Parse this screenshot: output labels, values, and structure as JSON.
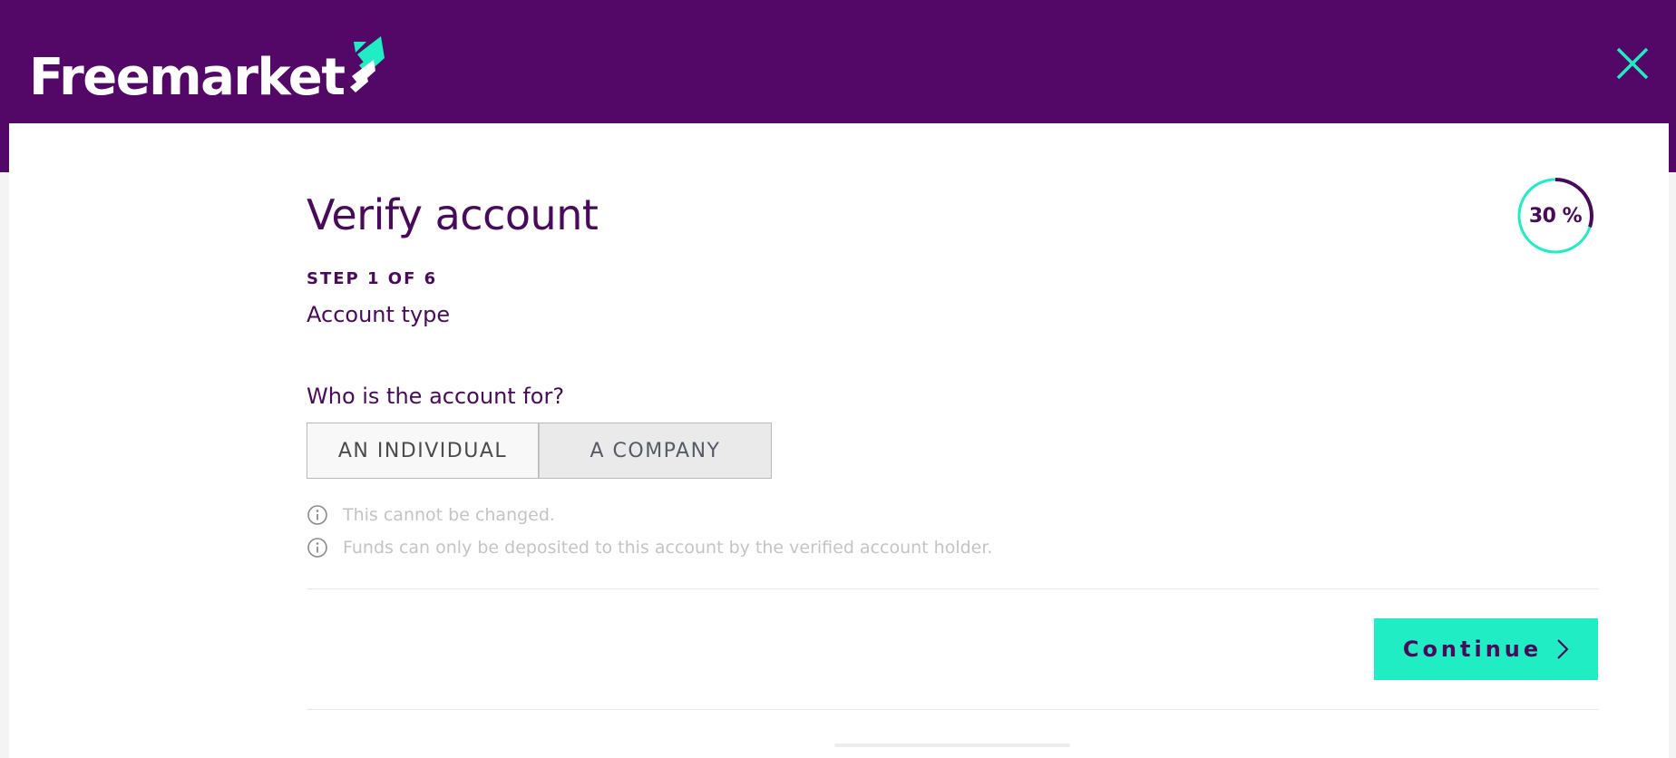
{
  "header": {
    "logo_text": "Freemarket",
    "close_icon": "close-icon",
    "colors": {
      "brand": "#530766",
      "accent": "#20edc4"
    }
  },
  "verify": {
    "title": "Verify account",
    "progress_label": "30 %",
    "progress_fraction": 0.3,
    "step_count": "STEP 1 OF 6",
    "step_name": "Account type",
    "question": "Who is the account for?",
    "options": [
      "AN INDIVIDUAL",
      "A COMPANY"
    ],
    "notes": [
      "This cannot be changed.",
      "Funds can only be deposited to this account by the verified account holder."
    ],
    "continue_label": "Continue"
  }
}
